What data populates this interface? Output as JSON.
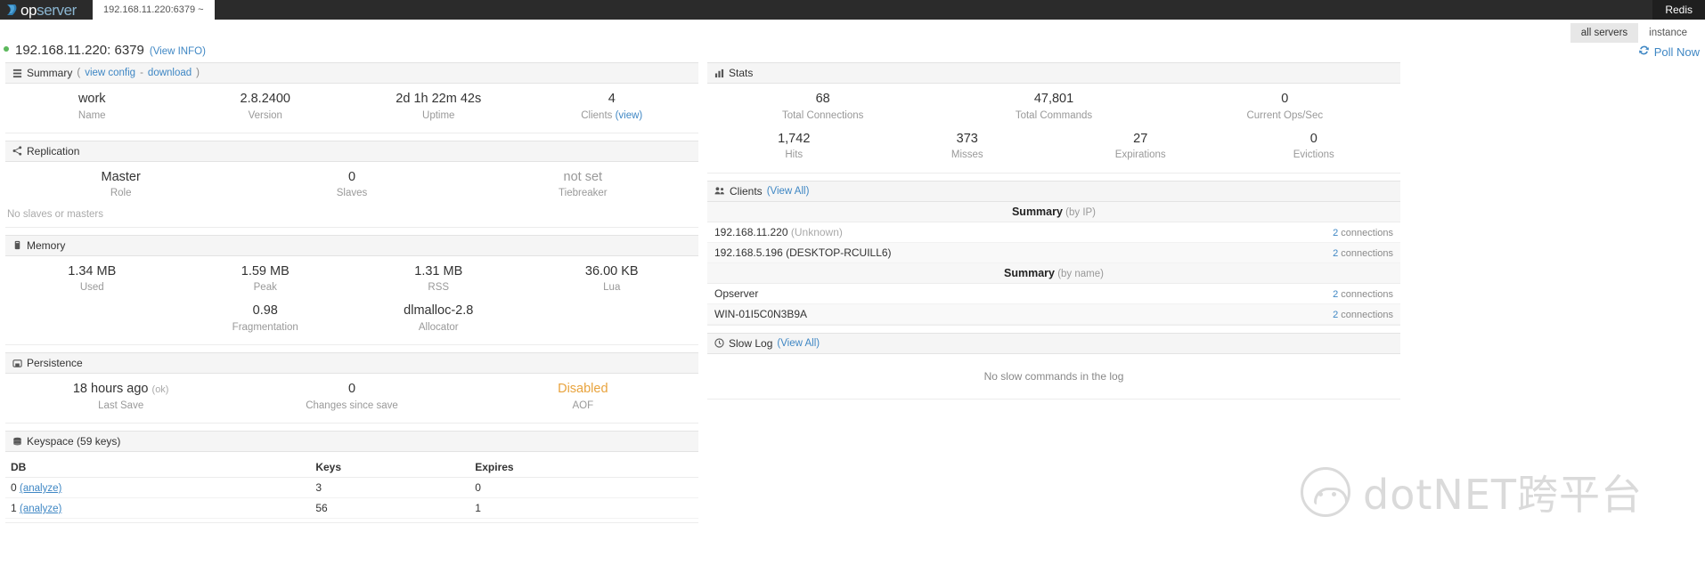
{
  "navbar": {
    "brand_op": "op",
    "brand_server": "server",
    "instance_selector": "192.168.11.220:6379 ~",
    "right_nav": "Redis"
  },
  "subbar": {
    "tabs": [
      {
        "label": "all servers",
        "active": true
      },
      {
        "label": "instance",
        "active": false
      }
    ]
  },
  "instance_header": {
    "title": "192.168.11.220: 6379",
    "view_info": "(View INFO)",
    "poll_now": "Poll Now",
    "refresh_icon": "refresh-icon"
  },
  "summary": {
    "head_icon": "list-icon",
    "head_title": "Summary",
    "head_open_paren": "(",
    "view_config": "view config",
    "head_dash": " - ",
    "download": "download",
    "head_close_paren": ")",
    "metrics": [
      {
        "value": "work",
        "label": "Name"
      },
      {
        "value": "2.8.2400",
        "label": "Version"
      },
      {
        "value": "2d 1h 22m 42s",
        "label": "Uptime"
      },
      {
        "value": "4",
        "label": "Clients ",
        "link": "(view)"
      }
    ]
  },
  "replication": {
    "head_icon": "share-icon",
    "head_title": "Replication",
    "metrics": [
      {
        "value": "Master",
        "label": "Role"
      },
      {
        "value": "0",
        "label": "Slaves"
      },
      {
        "value": "not set",
        "label": "Tiebreaker",
        "gray": true
      }
    ],
    "note": "No slaves or masters"
  },
  "memory": {
    "head_icon": "memory-icon",
    "head_title": "Memory",
    "metrics_row1": [
      {
        "value": "1.34 MB",
        "label": "Used"
      },
      {
        "value": "1.59 MB",
        "label": "Peak"
      },
      {
        "value": "1.31 MB",
        "label": "RSS"
      },
      {
        "value": "36.00 KB",
        "label": "Lua"
      }
    ],
    "metrics_row2": [
      {
        "value": "",
        "label": ""
      },
      {
        "value": "0.98",
        "label": "Fragmentation"
      },
      {
        "value": "dlmalloc-2.8",
        "label": "Allocator"
      },
      {
        "value": "",
        "label": ""
      }
    ]
  },
  "persistence": {
    "head_icon": "save-icon",
    "head_title": "Persistence",
    "metrics": [
      {
        "value": "18 hours ago ",
        "sub": "(ok)",
        "label": "Last Save"
      },
      {
        "value": "0",
        "label": "Changes since save"
      },
      {
        "value": "Disabled",
        "label": "AOF",
        "warn": true
      }
    ]
  },
  "keyspace": {
    "head_icon": "database-icon",
    "head_title": "Keyspace (59 keys)",
    "columns": [
      "DB",
      "Keys",
      "Expires"
    ],
    "rows": [
      {
        "db": "0 ",
        "analyze": "(analyze)",
        "keys": "3",
        "expires": "0"
      },
      {
        "db": "1 ",
        "analyze": "(analyze)",
        "keys": "56",
        "expires": "1"
      }
    ]
  },
  "stats": {
    "head_icon": "chart-icon",
    "head_title": "Stats",
    "metrics_row1": [
      {
        "value": "68",
        "label": "Total Connections"
      },
      {
        "value": "47,801",
        "label": "Total Commands"
      },
      {
        "value": "0",
        "label": "Current Ops/Sec"
      }
    ],
    "metrics_row2": [
      {
        "value": "1,742",
        "label": "Hits"
      },
      {
        "value": "373",
        "label": "Misses"
      },
      {
        "value": "27",
        "label": "Expirations"
      },
      {
        "value": "0",
        "label": "Evictions"
      }
    ]
  },
  "clients": {
    "head_icon": "users-icon",
    "head_title": "Clients",
    "view_all": "(View All)",
    "groups": [
      {
        "summary_title": "Summary",
        "summary_by": " (by IP)",
        "rows": [
          {
            "name": "192.168.11.220 ",
            "detail": "(Unknown)",
            "detail_dim": true,
            "count": "2",
            "unit": " connections"
          },
          {
            "name": "192.168.5.196 (DESKTOP-RCUILL6)",
            "detail": "",
            "detail_dim": false,
            "count": "2",
            "unit": " connections"
          }
        ]
      },
      {
        "summary_title": "Summary",
        "summary_by": " (by name)",
        "rows": [
          {
            "name": "Opserver",
            "detail": "",
            "detail_dim": false,
            "count": "2",
            "unit": " connections"
          },
          {
            "name": "WIN-01I5C0N3B9A",
            "detail": "",
            "detail_dim": false,
            "count": "2",
            "unit": " connections"
          }
        ]
      }
    ]
  },
  "slow_log": {
    "head_icon": "clock-icon",
    "head_title": "Slow Log",
    "view_all": "(View All)",
    "empty_message": "No slow commands in the log"
  },
  "watermark": {
    "text": "dotNET跨平台",
    "badge_icon": "panda-logo-icon"
  },
  "colors": {
    "link": "#3f87c4",
    "warn": "#e8a33d",
    "status_ok": "#5cb85c",
    "navbar_bg": "#2b2b2b"
  }
}
